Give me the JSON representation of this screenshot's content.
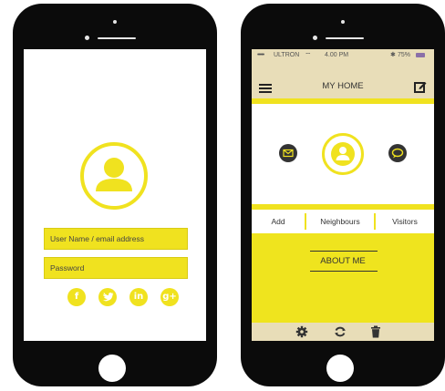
{
  "login": {
    "username_placeholder": "User Name / email address",
    "password_placeholder": "Password",
    "social": [
      {
        "icon": "facebook-icon",
        "glyph": "f"
      },
      {
        "icon": "twitter-icon",
        "glyph": "t"
      },
      {
        "icon": "linkedin-icon",
        "glyph": "in"
      },
      {
        "icon": "google-plus-icon",
        "glyph": "g+"
      }
    ]
  },
  "app": {
    "status": {
      "carrier": "ULTRON",
      "time": "4.00 PM",
      "battery": "75%"
    },
    "title": "MY HOME",
    "tabs": [
      "Add",
      "Neighbours",
      "Visitors"
    ],
    "about_label": "ABOUT ME"
  },
  "colors": {
    "accent": "#f0e21f",
    "dark": "#333333",
    "bar": "#e8ddb8"
  }
}
